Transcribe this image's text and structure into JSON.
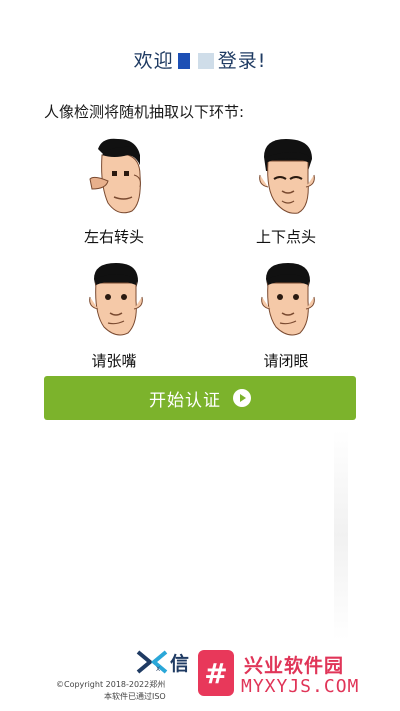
{
  "header": {
    "welcome_prefix": "欢迎",
    "welcome_suffix": "登录!"
  },
  "intro": "人像检测将随机抽取以下环节:",
  "actions": [
    {
      "label": "左右转头",
      "icon": "face-turn-head-icon"
    },
    {
      "label": "上下点头",
      "icon": "face-nod-icon"
    },
    {
      "label": "请张嘴",
      "icon": "face-open-mouth-icon"
    },
    {
      "label": "请闭眼",
      "icon": "face-close-eyes-icon"
    }
  ],
  "start_button": {
    "label": "开始认证",
    "icon": "play-icon"
  },
  "footer": {
    "brand": "信",
    "brand_sub": "X",
    "copyright": "©Copyright 2018-2022郑州",
    "iso": "本软件已通过ISO"
  },
  "watermark": {
    "symbol": "#",
    "title": "兴业软件园",
    "url": "MYXYJS.COM"
  },
  "colors": {
    "accent_green": "#7cb32c",
    "title_blue": "#1f3b63",
    "watermark_red": "#e03558"
  }
}
